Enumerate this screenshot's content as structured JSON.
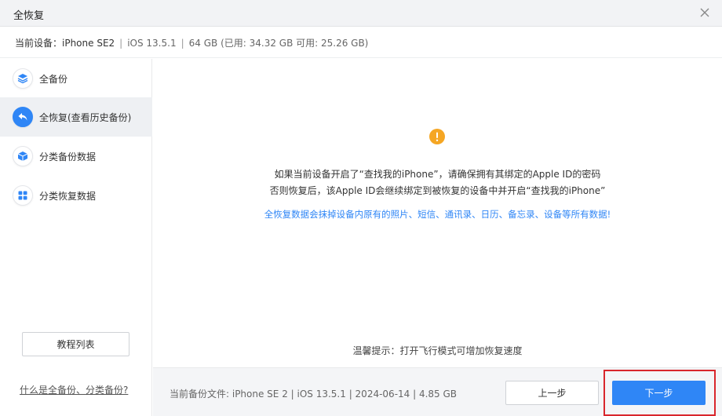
{
  "window": {
    "title": "全恢复",
    "close_icon": "close-icon"
  },
  "device": {
    "label": "当前设备：iPhone SE2",
    "separator": "|",
    "ios": "iOS 13.5.1",
    "storage": "64 GB (已用: 34.32 GB 可用: 25.26 GB)"
  },
  "sidebar": {
    "items": [
      {
        "label": "全备份",
        "icon": "layers-icon",
        "active": false
      },
      {
        "label": "全恢复(查看历史备份)",
        "icon": "restore-arrow-icon",
        "active": true
      },
      {
        "label": "分类备份数据",
        "icon": "box-icon",
        "active": false
      },
      {
        "label": "分类恢复数据",
        "icon": "grid-icon",
        "active": false
      }
    ],
    "tutorial_label": "教程列表",
    "faq_link": "什么是全备份、分类备份?"
  },
  "main": {
    "warning_icon": "exclamation-icon",
    "line1": "如果当前设备开启了“查找我的iPhone”，请确保拥有其绑定的Apple ID的密码",
    "line2": "否则恢复后，该Apple ID会继续绑定到被恢复的设备中并开启“查找我的iPhone”",
    "warning_line": "全恢复数据会抹掉设备内原有的照片、短信、通讯录、日历、备忘录、设备等所有数据!",
    "tip": "温馨提示：打开飞行模式可增加恢复速度"
  },
  "footer": {
    "file_info": "当前备份文件:  iPhone SE 2 | iOS 13.5.1 | 2024-06-14 | 4.85 GB",
    "prev_label": "上一步",
    "next_label": "下一步"
  },
  "colors": {
    "accent": "#2f86f6",
    "warning": "#f5a623",
    "highlight": "#d9262c"
  }
}
